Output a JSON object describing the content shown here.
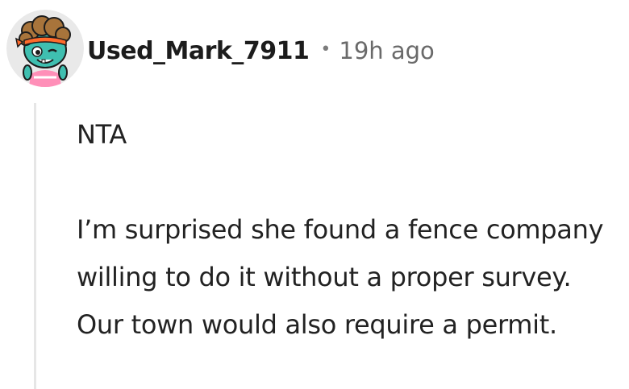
{
  "comment": {
    "username": "Used_Mark_7911",
    "separator": "•",
    "timestamp": "19h ago",
    "paragraphs": [
      "NTA",
      "I’m surprised she found a fence company willing to do it without a proper survey. Our town would also require a permit."
    ],
    "avatar": {
      "icon": "snoo-avatar-icon",
      "colors": {
        "background": "#e9e9e9",
        "hair": "#a8743b",
        "skin": "#3fbfb0",
        "headband": "#ff6b2c",
        "shirt": "#ff8fb8"
      }
    }
  }
}
